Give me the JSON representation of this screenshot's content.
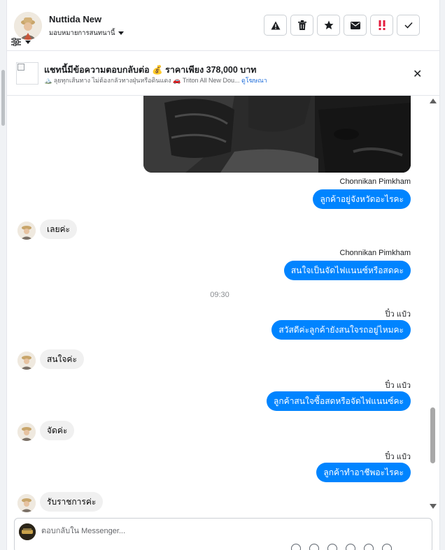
{
  "header": {
    "name": "Nuttida New",
    "assign_label": "มอบหมายการสนทนานี้"
  },
  "actions": [
    {
      "icon": "warning-icon"
    },
    {
      "icon": "trash-icon"
    },
    {
      "icon": "star-icon"
    },
    {
      "icon": "mail-icon"
    },
    {
      "icon": "urgent-icon",
      "color": "#e41e3f"
    },
    {
      "icon": "check-icon"
    }
  ],
  "ad": {
    "title": "แชทนี้มีข้อความตอบกลับต่อ 💰 ราคาเพียง 378,000 บาท",
    "subtitle": "🏔️ ลุยทุกเส้นทาง ไม่ต้องกลัวทางฝุ่นหรือดินแดง 🚗 Triton All New Dou...",
    "link": "ดูโฆษณา"
  },
  "messages": {
    "m1": {
      "sender": "Chonnikan Pimkham",
      "text": "ลูกค้าอยู่จังหวัดอะไรคะ"
    },
    "m2": {
      "text": "เลยค่ะ"
    },
    "m3": {
      "sender": "Chonnikan Pimkham",
      "text": "สนใจเป็นจัดไฟแนนซ์หรือสดคะ"
    },
    "time1": "09:30",
    "m4": {
      "sender": "ปิ๋ว แป๋ว",
      "text": "สวัสดีค่ะลูกค้ายังสนใจรถอยู่ไหมคะ"
    },
    "m5": {
      "text": "สนใจค่ะ"
    },
    "m6": {
      "sender": "ปิ๋ว แป๋ว",
      "text": "ลูกค้าสนใจซื้อสดหรือจัดไฟแนนซ์คะ"
    },
    "m7": {
      "text": "จัดค่ะ"
    },
    "m8": {
      "sender": "ปิ๋ว แป๋ว",
      "text": "ลูกค้าทำอาชีพอะไรคะ"
    },
    "m9": {
      "text": "รับราชการค่ะ"
    }
  },
  "composer": {
    "placeholder": "ตอบกลับใน Messenger..."
  },
  "colors": {
    "accent": "#0084ff",
    "incoming": "#f0f0f0"
  }
}
